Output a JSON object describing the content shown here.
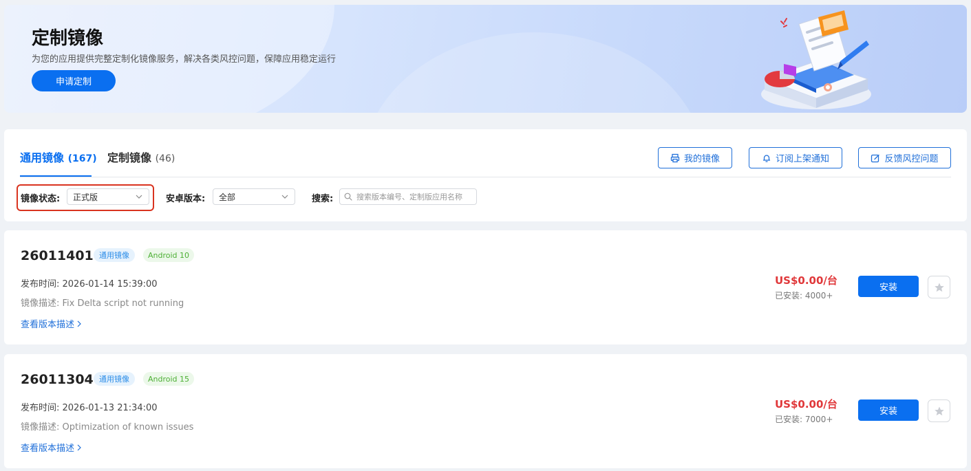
{
  "banner": {
    "title": "定制镜像",
    "subtitle": "为您的应用提供完整定制化镜像服务，解决各类风控问题，保障应用稳定运行",
    "apply_button": "申请定制"
  },
  "tabs": [
    {
      "label": "通用镜像",
      "count": "(167)",
      "active": true
    },
    {
      "label": "定制镜像",
      "count": "(46)",
      "active": false
    }
  ],
  "actions": {
    "my_images": "我的镜像",
    "subscribe": "订阅上架通知",
    "feedback": "反馈风控问题"
  },
  "filters": {
    "status_label": "镜像状态:",
    "status_value": "正式版",
    "android_label": "安卓版本:",
    "android_value": "全部",
    "search_label": "搜索:",
    "search_placeholder": "搜索版本编号、定制版应用名称"
  },
  "images": [
    {
      "id": "26011401",
      "type_tag": "通用镜像",
      "android_tag": "Android 10",
      "publish_time": "发布时间: 2026-01-14 15:39:00",
      "description": "镜像描述: Fix Delta script not running",
      "view_link": "查看版本描述",
      "price": "US$0.00/台",
      "installed": "已安装: 4000+",
      "install_button": "安装"
    },
    {
      "id": "26011304",
      "type_tag": "通用镜像",
      "android_tag": "Android 15",
      "publish_time": "发布时间: 2026-01-13 21:34:00",
      "description": "镜像描述: Optimization of known issues",
      "view_link": "查看版本描述",
      "price": "US$0.00/台",
      "installed": "已安装: 7000+",
      "install_button": "安装"
    }
  ],
  "colors": {
    "accent": "#0a6ff0",
    "price": "#e0383a",
    "highlight": "#d9331f"
  }
}
